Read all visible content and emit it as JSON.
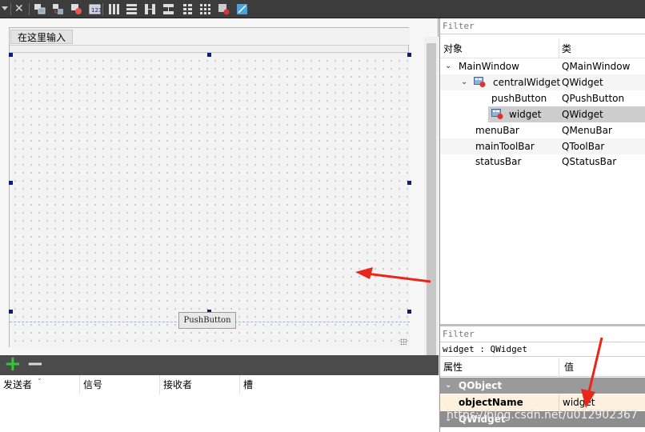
{
  "toolbar": {
    "icons": [
      "dropdown-icon",
      "close-icon",
      "edit-widgets-icon",
      "edit-signals-slots-icon",
      "edit-buddies-icon",
      "edit-tab-order-icon",
      "layout-horizontal-icon",
      "layout-vertical-icon",
      "layout-h-splitter-icon",
      "layout-v-splitter-icon",
      "layout-form-icon",
      "layout-grid-icon",
      "break-layout-icon",
      "adjust-size-icon"
    ]
  },
  "form": {
    "menu_placeholder": "在这里输入",
    "pushbutton_label": "PushButton"
  },
  "signal_slot": {
    "add_label": "+",
    "remove_label": "−",
    "columns": [
      "发送者",
      "信号",
      "接收者",
      "槽"
    ]
  },
  "object_inspector": {
    "filter_placeholder": "Filter",
    "columns": {
      "object": "对象",
      "class": "类"
    },
    "rows": [
      {
        "name": "MainWindow",
        "class": "QMainWindow"
      },
      {
        "name": "centralWidget",
        "class": "QWidget"
      },
      {
        "name": "pushButton",
        "class": "QPushButton"
      },
      {
        "name": "widget",
        "class": "QWidget"
      },
      {
        "name": "menuBar",
        "class": "QMenuBar"
      },
      {
        "name": "mainToolBar",
        "class": "QToolBar"
      },
      {
        "name": "statusBar",
        "class": "QStatusBar"
      }
    ]
  },
  "property_editor": {
    "filter_placeholder": "Filter",
    "selected_label": "widget : QWidget",
    "columns": {
      "property": "属性",
      "value": "值"
    },
    "groups": [
      "QObject",
      "QWidget"
    ],
    "object_name_label": "objectName",
    "object_name_value": "widget"
  },
  "watermark": "https://blog.csdn.net/u012902367",
  "colors": {
    "arrow": "#e8261a",
    "selection": "#0a1c8a"
  }
}
